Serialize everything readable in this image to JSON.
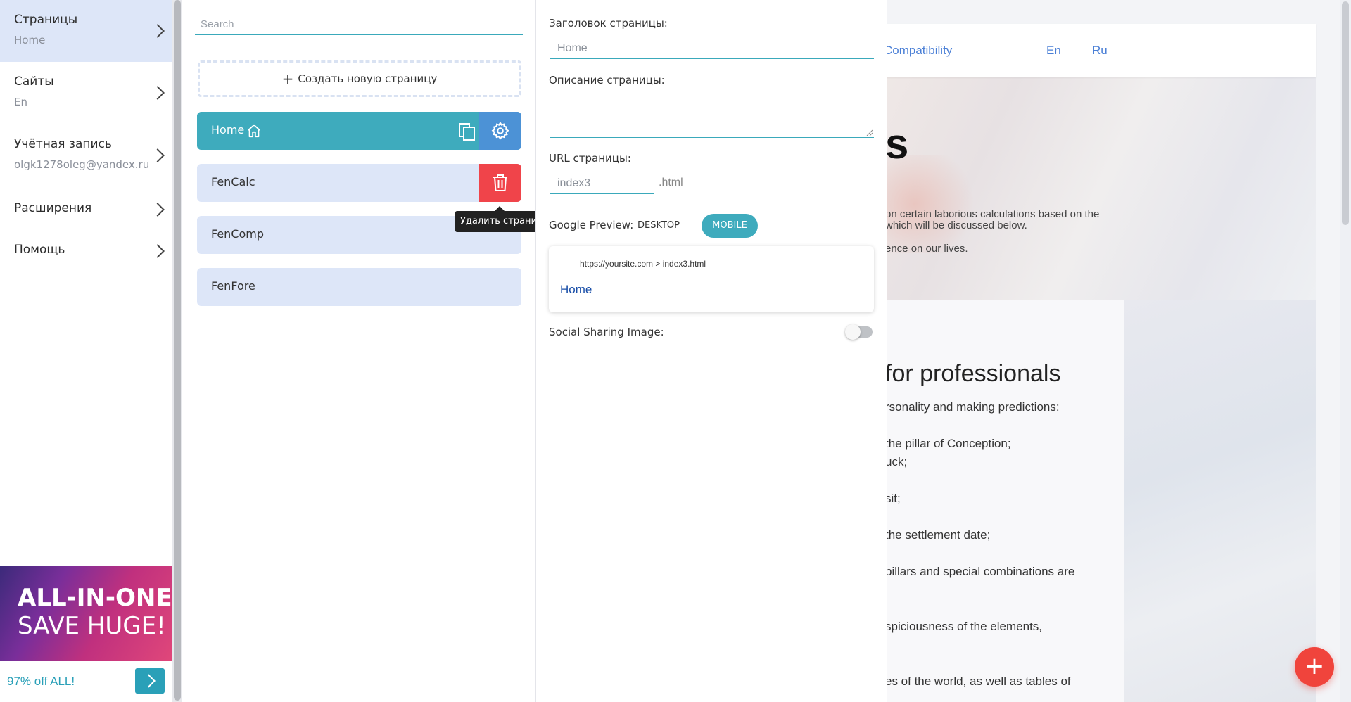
{
  "sidebar": {
    "items": [
      {
        "label": "Страницы",
        "sub": "Home"
      },
      {
        "label": "Сайты",
        "sub": "En"
      },
      {
        "label": "Учётная запись",
        "sub": "olgk1278oleg@yandex.ru"
      },
      {
        "label": "Расширения",
        "sub": ""
      },
      {
        "label": "Помощь",
        "sub": ""
      }
    ],
    "promo": {
      "line1": "ALL-IN-ONE",
      "line2": "SAVE HUGE!",
      "offer": "97% off ALL!"
    }
  },
  "pages_panel": {
    "search_placeholder": "Search",
    "create_label": "Создать новую страницу",
    "pages": [
      {
        "name": "Home",
        "active": true
      },
      {
        "name": "FenCalc"
      },
      {
        "name": "FenComp"
      },
      {
        "name": "FenFore"
      }
    ],
    "delete_tooltip": "Удалить страницу"
  },
  "settings": {
    "title_label": "Заголовок страницы:",
    "title_placeholder": "Home",
    "description_label": "Описание страницы:",
    "url_label": "URL страницы:",
    "url_placeholder": "index3",
    "url_suffix": ".html",
    "google_preview_label": "Google Preview:",
    "desktop_label": "DESKTOP",
    "mobile_label": "MOBILE",
    "selected_mode": "MOBILE",
    "preview_url": "https://yoursite.com > index3.html",
    "preview_title": "Home",
    "social_label": "Social Sharing Image:",
    "social_enabled": false
  },
  "site_preview": {
    "nav": {
      "compat": "Compatibility",
      "en": "En",
      "ru": "Ru"
    },
    "heading_fragment": "s",
    "intro_lines": [
      "on certain laborious calculations based on the",
      "which will be discussed below.",
      "ence on our lives."
    ],
    "section_heading": "for professionals",
    "bullets": [
      "rsonality and making predictions:",
      "the pillar of Conception;",
      "uck;",
      "sit;",
      "the settlement date;",
      "pillars and special combinations are",
      "spiciousness of the elements,",
      "es of the world, as well as tables of"
    ],
    "fab_symbol": "+"
  },
  "colors": {
    "accent": "#3eabbd",
    "primary": "#4c92d6",
    "danger": "#f0444a",
    "item_bg": "#dde6f8",
    "fab": "#f0443c"
  }
}
